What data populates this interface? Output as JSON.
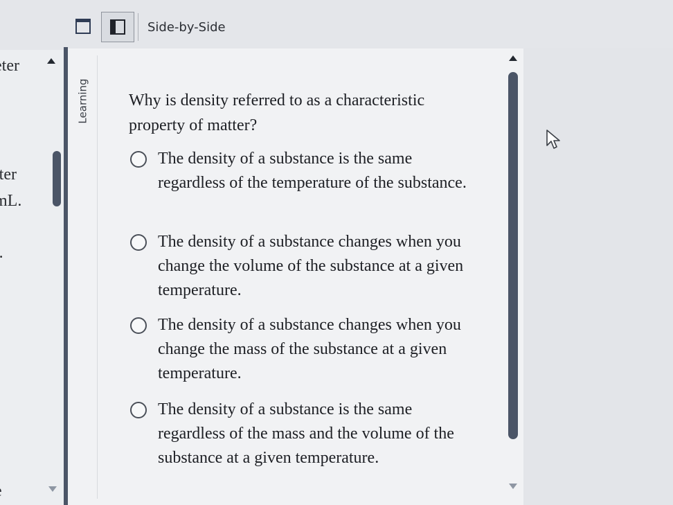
{
  "toolbar": {
    "mode_label": "Side-by-Side",
    "single_view_icon": "single-pane-icon",
    "split_view_icon": "split-pane-icon"
  },
  "left_pane": {
    "fragments": [
      "eter",
      "tter",
      "mL.",
      "r.",
      "e"
    ]
  },
  "tab": {
    "label": "Learning"
  },
  "question": {
    "text": "Why is density referred to as a characteristic property of matter?",
    "options": [
      {
        "label": "The density of a substance is the same regardless of the temperature of the substance."
      },
      {
        "label": "The density of a substance changes when you change the volume of the substance at a given temperature."
      },
      {
        "label": "The density of a substance changes when you change the mass of the substance at a given temperature."
      },
      {
        "label": "The density of a substance is the same regardless of the mass and the volume of the substance at a given temperature."
      }
    ]
  },
  "colors": {
    "scrollbar": "#4b5567",
    "panel_bg": "#f1f2f4",
    "toolbar_icon": "#2f3c55"
  },
  "icons": [
    "cursor-arrow-icon",
    "scroll-up-arrow-icon",
    "scroll-down-arrow-icon",
    "radio-unselected-icon"
  ]
}
